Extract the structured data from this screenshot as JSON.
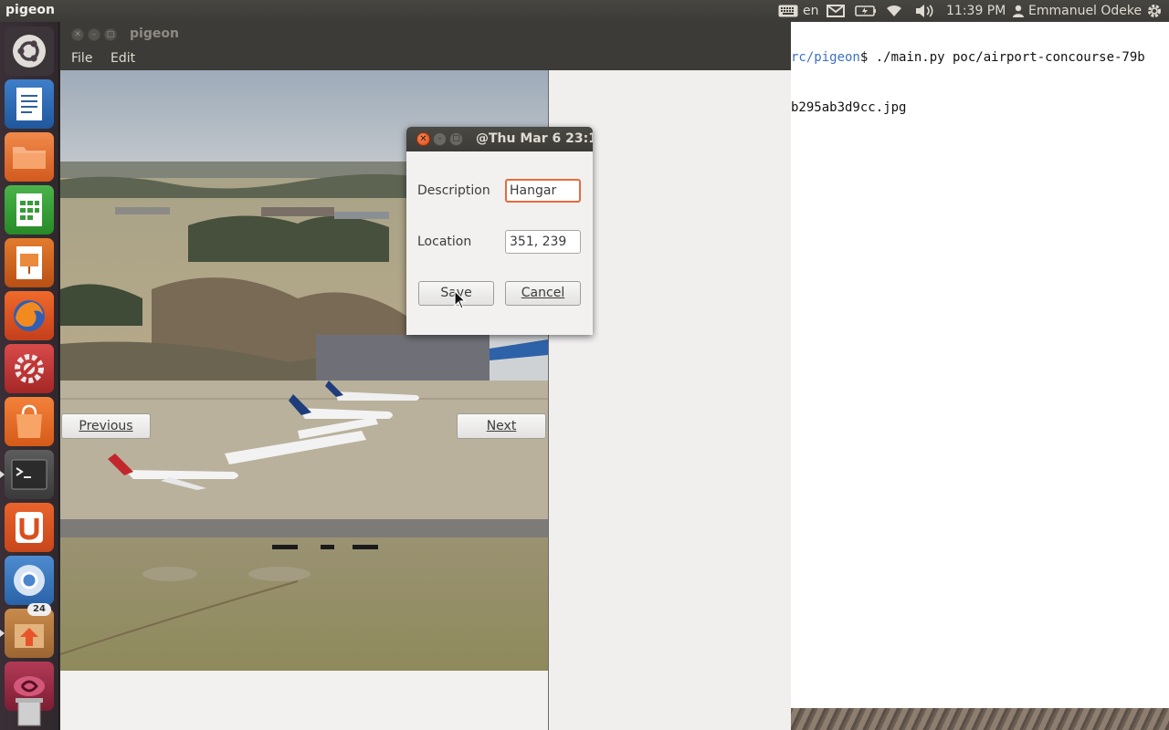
{
  "top_panel": {
    "app_title": "pigeon",
    "keyboard_layout": "en",
    "time": "11:39 PM",
    "user_name": "Emmanuel Odeke"
  },
  "launcher": {
    "items": [
      {
        "name": "ubuntu-dash-icon"
      },
      {
        "name": "libreoffice-writer-icon"
      },
      {
        "name": "files-icon"
      },
      {
        "name": "libreoffice-calc-icon"
      },
      {
        "name": "libreoffice-impress-icon"
      },
      {
        "name": "firefox-icon"
      },
      {
        "name": "system-settings-icon"
      },
      {
        "name": "software-center-icon"
      },
      {
        "name": "terminal-icon"
      },
      {
        "name": "ubuntu-one-icon"
      },
      {
        "name": "chromium-icon"
      },
      {
        "name": "software-updater-icon",
        "badge": "24"
      },
      {
        "name": "app-icon"
      },
      {
        "name": "trash-icon"
      }
    ]
  },
  "terminal": {
    "path": "rc/pigeon",
    "command": "$ ./main.py poc/airport-concourse-79b",
    "output": "b295ab3d9cc.jpg"
  },
  "pigeon_window": {
    "title": "pigeon",
    "menu": [
      "File",
      "Edit"
    ],
    "previous_label": "Previous",
    "next_label": "Next"
  },
  "dialog": {
    "title": "@Thu Mar  6 23:1",
    "description_label": "Description",
    "description_value": "Hangar",
    "location_label": "Location",
    "location_value": "351, 239",
    "save_label": "Save",
    "cancel_label": "Cancel"
  }
}
